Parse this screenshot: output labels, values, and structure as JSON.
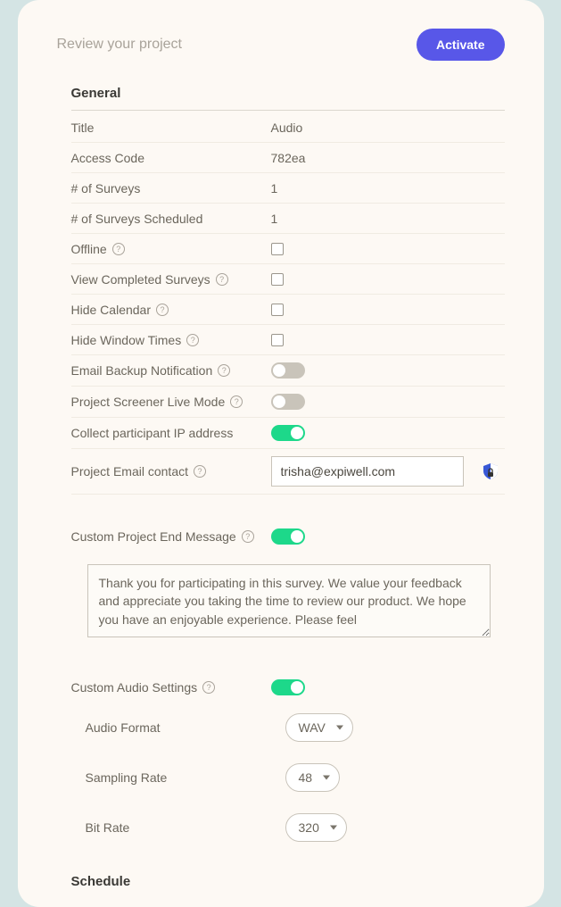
{
  "header": {
    "title": "Review your project",
    "activate_label": "Activate"
  },
  "sections": {
    "general": {
      "title": "General"
    },
    "schedule": {
      "title": "Schedule"
    }
  },
  "general": {
    "title_label": "Title",
    "title_value": "Audio",
    "access_code_label": "Access Code",
    "access_code_value": "782ea",
    "num_surveys_label": "# of Surveys",
    "num_surveys_value": "1",
    "num_surveys_scheduled_label": "# of Surveys Scheduled",
    "num_surveys_scheduled_value": "1",
    "offline_label": "Offline",
    "view_completed_label": "View Completed Surveys",
    "hide_calendar_label": "Hide Calendar",
    "hide_window_label": "Hide Window Times",
    "email_backup_label": "Email Backup Notification",
    "screener_live_label": "Project Screener Live Mode",
    "collect_ip_label": "Collect participant IP address",
    "email_contact_label": "Project Email contact",
    "email_contact_value": "trisha@expiwell.com",
    "end_msg_label": "Custom Project End Message",
    "end_msg_value": "Thank you for participating in this survey. We value your feedback and appreciate you taking the time to review our product. We hope you have an enjoyable experience. Please feel",
    "audio_settings_label": "Custom Audio Settings"
  },
  "audio": {
    "format_label": "Audio Format",
    "format_value": "WAV",
    "sampling_label": "Sampling Rate",
    "sampling_value": "48",
    "bitrate_label": "Bit Rate",
    "bitrate_value": "320"
  },
  "help": "?"
}
